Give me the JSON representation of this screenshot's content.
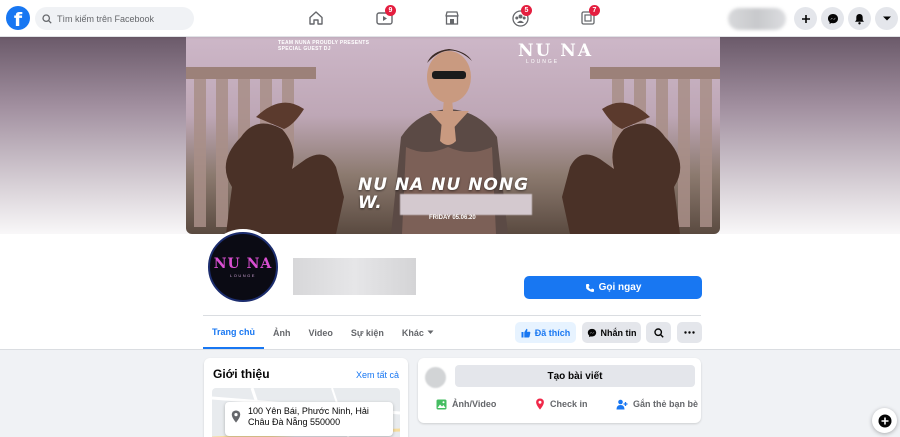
{
  "topbar": {
    "logo_letter": "f",
    "search_placeholder": "Tìm kiếm trên Facebook",
    "nav": [
      {
        "icon": "home-icon",
        "badge": ""
      },
      {
        "icon": "watch-icon",
        "badge": "9"
      },
      {
        "icon": "marketplace-icon",
        "badge": ""
      },
      {
        "icon": "groups-icon",
        "badge": "5"
      },
      {
        "icon": "gaming-icon",
        "badge": "7"
      }
    ],
    "right_buttons": [
      "plus-icon",
      "messenger-icon",
      "bell-icon",
      "caret-down-icon"
    ]
  },
  "cover": {
    "presenter_line1": "TEAM NUNA PROUDLY PRESENTS",
    "presenter_line2": "SPECIAL GUEST DJ",
    "brand": "NU NA",
    "brand_sub": "LOUNGE",
    "event_title": "NU NA NU NONG",
    "event_prefix": "W.",
    "event_date": "FRIDAY 05.06.20"
  },
  "page": {
    "avatar_brand": "NU NA",
    "avatar_sub": "LOUNGE",
    "call_button": "Gọi ngay",
    "tabs": [
      "Trang chủ",
      "Ảnh",
      "Video",
      "Sự kiện",
      "Khác"
    ],
    "liked_button": "Đã thích",
    "message_button": "Nhắn tin"
  },
  "intro": {
    "title": "Giới thiệu",
    "see_all": "Xem tất cả",
    "address_line1": "100 Yên Bái, Phước Ninh, Hải",
    "address_line2": "Châu Đà Nẵng 550000"
  },
  "composer": {
    "create_post": "Tạo bài viết",
    "photo_video": "Ảnh/Video",
    "check_in": "Check in",
    "tag_friends": "Gắn thẻ bạn bè"
  },
  "colors": {
    "accent": "#1877f2",
    "badge": "#e41e3f",
    "background": "#f0f2f5"
  }
}
